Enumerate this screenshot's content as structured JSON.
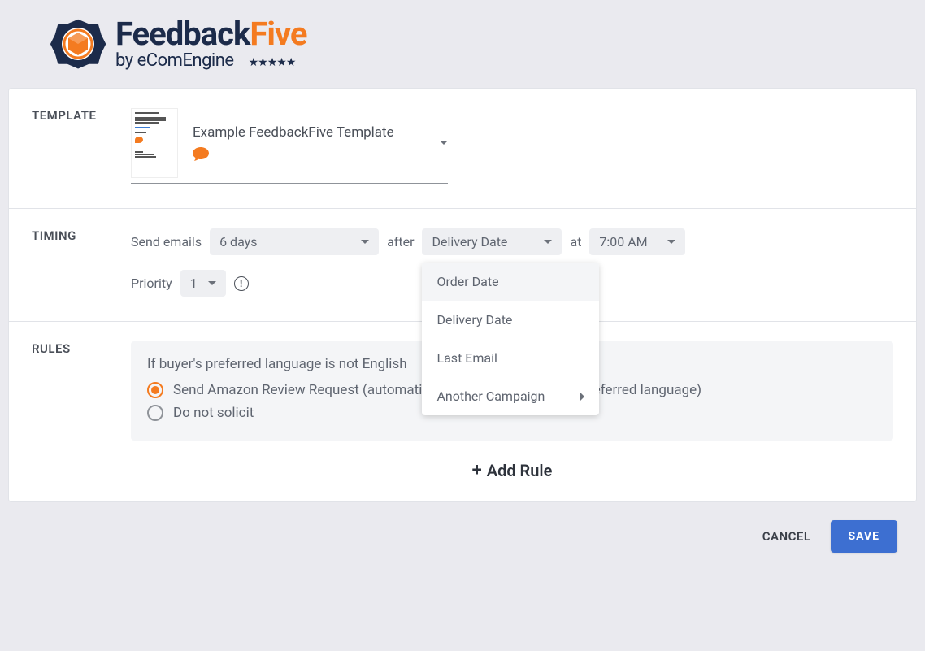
{
  "brand": {
    "name_part1": "Feedback",
    "name_part2": "Five",
    "subtitle": "by eComEngine"
  },
  "sections": {
    "template_label": "TEMPLATE",
    "timing_label": "TIMING",
    "rules_label": "RULES"
  },
  "template": {
    "selected": "Example FeedbackFive Template"
  },
  "timing": {
    "send_emails_label": "Send emails",
    "days_value": "6 days",
    "after_label": "after",
    "date_type_value": "Delivery Date",
    "at_label": "at",
    "time_value": "7:00 AM",
    "priority_label": "Priority",
    "priority_value": "1",
    "date_type_options": [
      "Order Date",
      "Delivery Date",
      "Last Email",
      "Another Campaign"
    ]
  },
  "rules": {
    "condition_text": "If buyer's preferred language is not English",
    "option_send": "Send Amazon Review Request (automatically translated to buyer's preferred language)",
    "option_skip": "Do not solicit",
    "selected": "send",
    "add_rule_label": "Add Rule"
  },
  "footer": {
    "cancel": "CANCEL",
    "save": "SAVE"
  }
}
